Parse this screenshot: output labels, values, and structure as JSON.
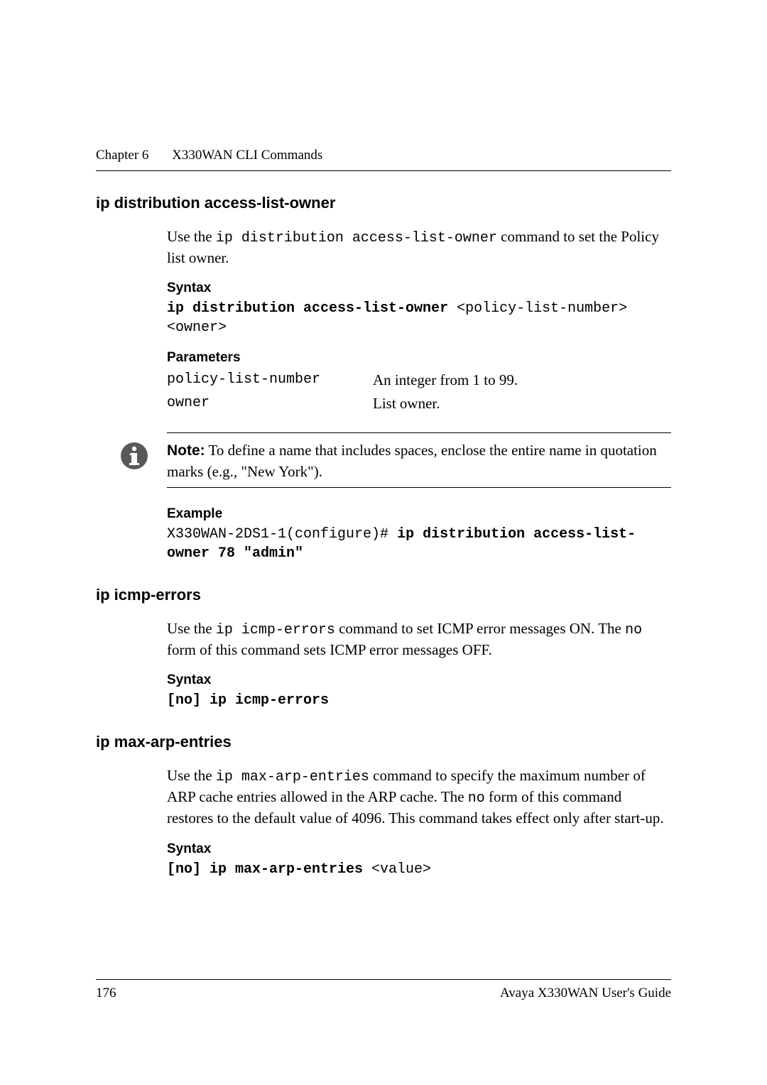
{
  "running_head": {
    "chapter": "Chapter 6",
    "title": "X330WAN CLI Commands"
  },
  "sections": {
    "s1": {
      "title": "ip distribution access-list-owner",
      "intro_pre": "Use the ",
      "intro_code": "ip distribution access-list-owner",
      "intro_post": " command to set the Policy list owner.",
      "syntax_label": "Syntax",
      "syntax_cmd": "ip distribution access-list-owner",
      "syntax_args": " <policy-list-number> <owner>",
      "params_label": "Parameters",
      "params": [
        {
          "name": "policy-list-number",
          "desc": "An integer from 1 to 99."
        },
        {
          "name": "owner",
          "desc": "List owner."
        }
      ],
      "note_label": "Note:",
      "note_text": "  To define a name that includes spaces, enclose the entire name in quotation marks (e.g., \"New York\").",
      "example_label": "Example",
      "example_prompt": "X330WAN-2DS1-1(configure)# ",
      "example_cmd": "ip distribution access-list-owner 78 \"admin\""
    },
    "s2": {
      "title": "ip icmp-errors",
      "intro_pre": "Use the ",
      "intro_code1": "ip icmp-errors",
      "intro_mid1": " command to set ICMP error messages ON. The ",
      "intro_code2": "no",
      "intro_post": " form of this command sets ICMP error messages OFF.",
      "syntax_label": "Syntax",
      "syntax_cmd": "[no] ip icmp-errors"
    },
    "s3": {
      "title": "ip max-arp-entries",
      "intro_pre": "Use the ",
      "intro_code1": "ip max-arp-entries",
      "intro_mid1": " command to specify the maximum number of ARP cache entries allowed in the ARP cache. The ",
      "intro_code2": "no",
      "intro_post": " form of this command restores to the default value of 4096. This command takes effect only after start-up.",
      "syntax_label": "Syntax",
      "syntax_cmd": "[no] ip max-arp-entries",
      "syntax_args": " <value>"
    }
  },
  "footer": {
    "page_number": "176",
    "doc_title": "Avaya X330WAN User's Guide"
  }
}
